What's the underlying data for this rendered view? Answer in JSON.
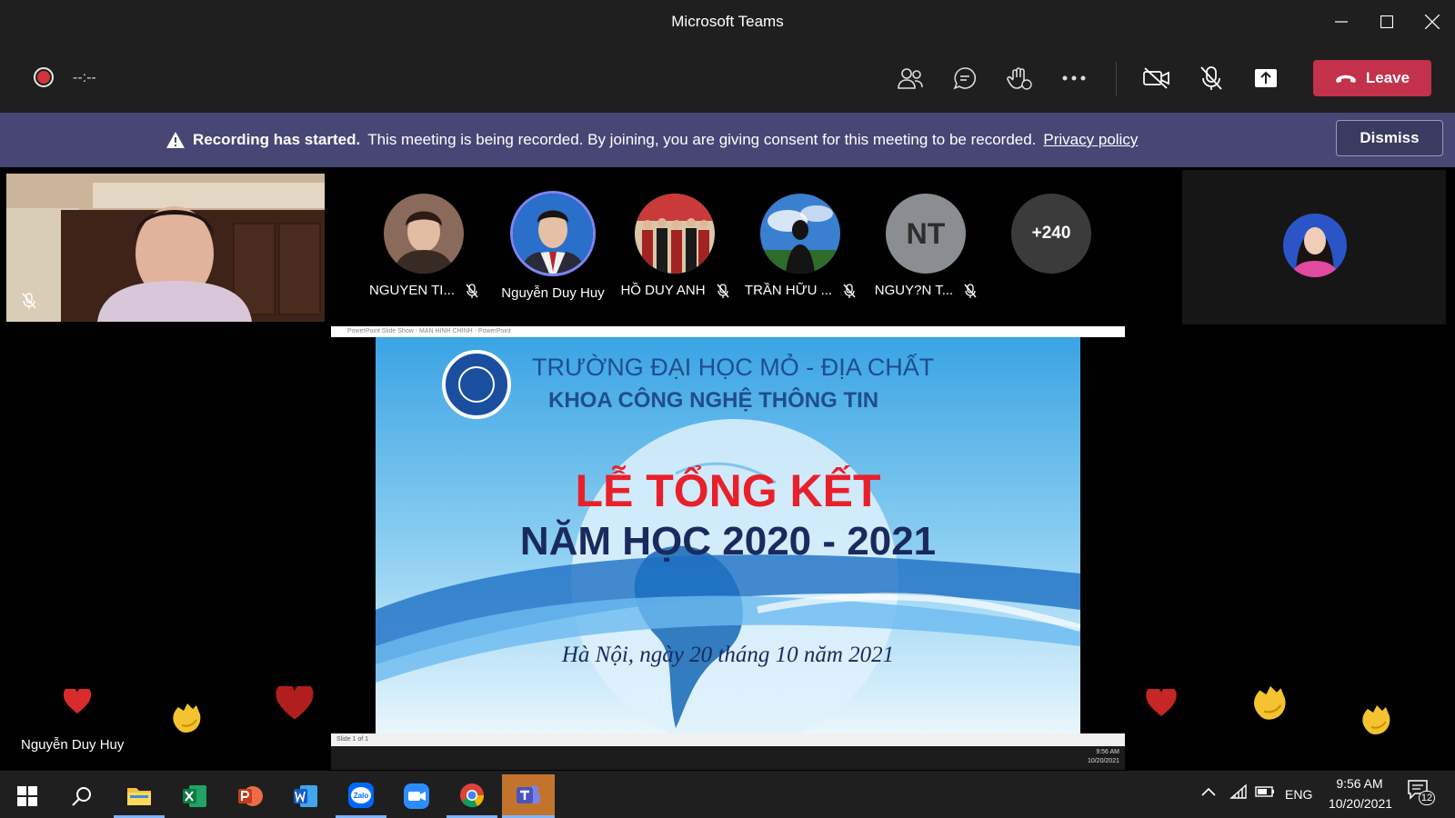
{
  "window": {
    "title": "Microsoft Teams"
  },
  "toolbar": {
    "recording_timer": "--:--",
    "leave_label": "Leave"
  },
  "banner": {
    "heading": "Recording has started.",
    "message": "This meeting is being recorded. By joining, you are giving consent for this meeting to be recorded.",
    "link": "Privacy policy",
    "dismiss": "Dismiss"
  },
  "participants": [
    {
      "name": "NGUYEN TI...",
      "muted": true
    },
    {
      "name": "Nguyễn Duy Huy",
      "muted": false,
      "speaking": true
    },
    {
      "name": "HỒ DUY ANH",
      "muted": true
    },
    {
      "name": "TRẦN HỮU ...",
      "muted": true
    },
    {
      "name": "NGUY?N T...",
      "initials": "NT",
      "muted": true
    }
  ],
  "overflow_count": "+240",
  "speaker_label": "Nguyễn Duy Huy",
  "shared_screen": {
    "window_title": "PowerPoint Slide Show - MAN HINH CHINH - PowerPoint",
    "slide": {
      "school": "TRƯỜNG ĐẠI HỌC MỎ - ĐỊA CHẤT",
      "faculty": "KHOA CÔNG NGHỆ THÔNG TIN",
      "event": "LỄ TỔNG KẾT",
      "year": "NĂM HỌC 2020 - 2021",
      "date": "Hà Nội, ngày 20 tháng 10 năm 2021"
    },
    "status": "Slide 1 of 1",
    "inner_time": "9:56 AM",
    "inner_date": "10/20/2021"
  },
  "taskbar": {
    "language": "ENG",
    "time": "9:56 AM",
    "date": "10/20/2021",
    "notifications": "12",
    "apps": [
      "start",
      "search",
      "file-explorer",
      "excel",
      "powerpoint",
      "word",
      "zalo",
      "zoom",
      "chrome",
      "teams"
    ]
  },
  "colors": {
    "leave": "#c4314b",
    "banner": "#464775",
    "accent": "#6264a7"
  }
}
